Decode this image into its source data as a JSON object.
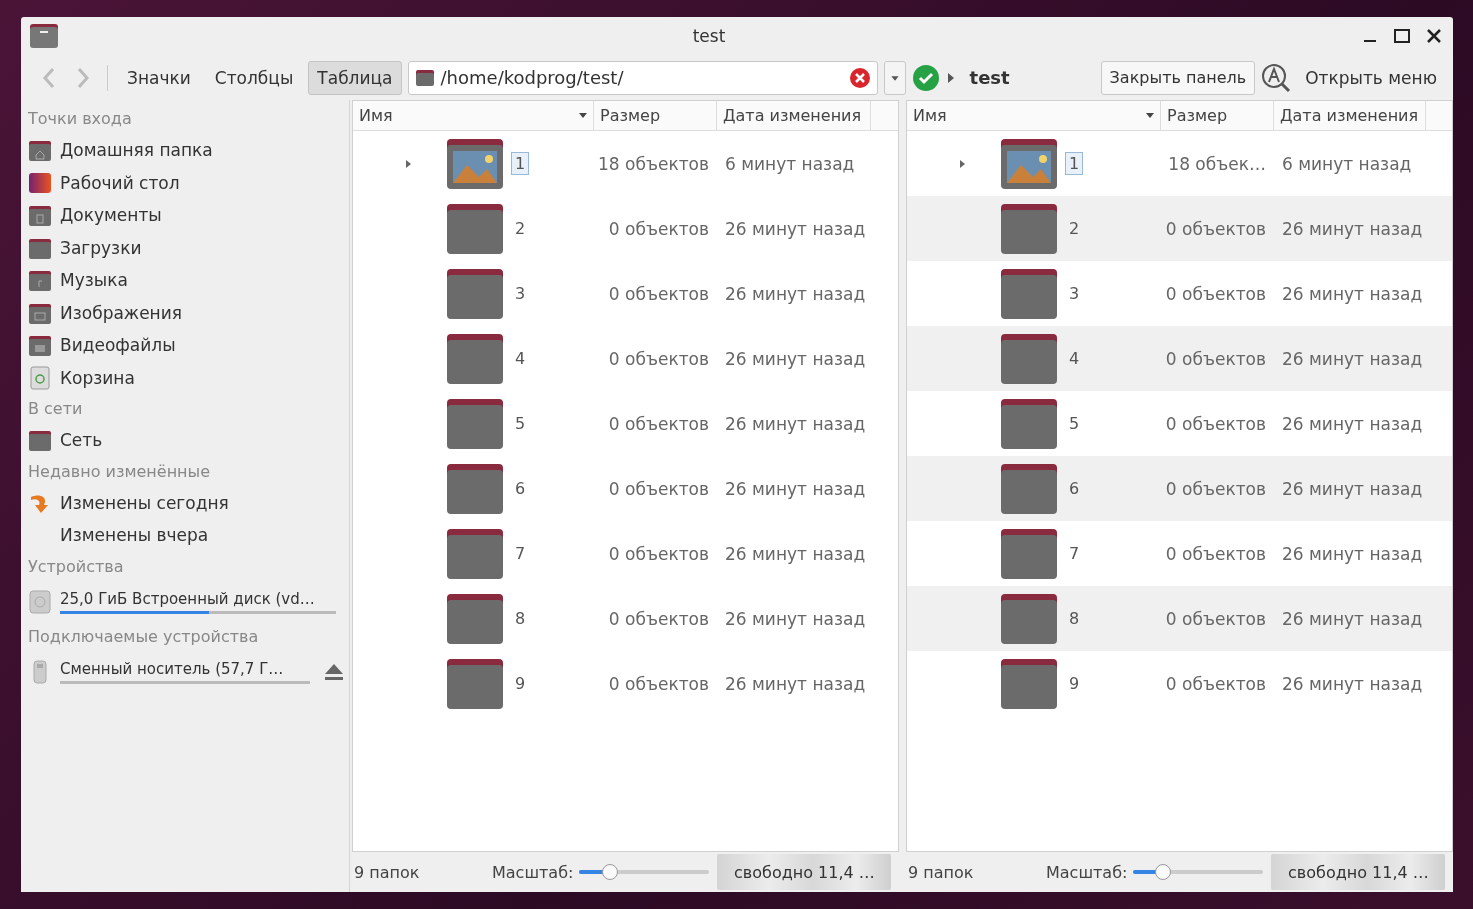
{
  "window": {
    "title": "test"
  },
  "toolbar": {
    "view_buttons": [
      {
        "label": "Значки",
        "selected": false
      },
      {
        "label": "Столбцы",
        "selected": false
      },
      {
        "label": "Таблица",
        "selected": true
      }
    ],
    "path": "/home/kodprog/test/",
    "breadcrumb": "test",
    "close_panel": "Закрыть панель",
    "open_menu": "Открыть меню"
  },
  "sidebar": {
    "sections": [
      {
        "title": "Точки входа",
        "items": [
          {
            "label": "Домашняя папка",
            "kind": "home"
          },
          {
            "label": "Рабочий стол",
            "kind": "desktop"
          },
          {
            "label": "Документы",
            "kind": "documents"
          },
          {
            "label": "Загрузки",
            "kind": "folder"
          },
          {
            "label": "Музыка",
            "kind": "music"
          },
          {
            "label": "Изображения",
            "kind": "pictures"
          },
          {
            "label": "Видеофайлы",
            "kind": "videos"
          },
          {
            "label": "Корзина",
            "kind": "trash"
          }
        ]
      },
      {
        "title": "В сети",
        "items": [
          {
            "label": "Сеть",
            "kind": "folder"
          }
        ]
      },
      {
        "title": "Недавно изменённые",
        "items": [
          {
            "label": "Изменены сегодня",
            "kind": "recent"
          },
          {
            "label": "Изменены вчера",
            "kind": "plain"
          }
        ]
      },
      {
        "title": "Устройства",
        "items": [
          {
            "label": "25,0 ГиБ Встроенный диск (vd…",
            "kind": "disk",
            "level": 0.54,
            "eject": false
          }
        ]
      },
      {
        "title": "Подключаемые устройства",
        "items": [
          {
            "label": "Сменный носитель (57,7 Г…",
            "kind": "usb",
            "level": 0,
            "eject": true
          }
        ]
      }
    ]
  },
  "panes": [
    {
      "striped": false,
      "columns": [
        {
          "label": "Имя",
          "sorted": true
        },
        {
          "label": "Размер",
          "sorted": false
        },
        {
          "label": "Дата изменения",
          "sorted": false
        }
      ],
      "rows": [
        {
          "name": "1",
          "size": "18 объектов",
          "modified": "6 минут назад",
          "kind": "image-folder",
          "expandable": true,
          "focused": true
        },
        {
          "name": "2",
          "size": "0 объектов",
          "modified": "26 минут назад",
          "kind": "folder",
          "expandable": false,
          "focused": false
        },
        {
          "name": "3",
          "size": "0 объектов",
          "modified": "26 минут назад",
          "kind": "folder",
          "expandable": false,
          "focused": false
        },
        {
          "name": "4",
          "size": "0 объектов",
          "modified": "26 минут назад",
          "kind": "folder",
          "expandable": false,
          "focused": false
        },
        {
          "name": "5",
          "size": "0 объектов",
          "modified": "26 минут назад",
          "kind": "folder",
          "expandable": false,
          "focused": false
        },
        {
          "name": "6",
          "size": "0 объектов",
          "modified": "26 минут назад",
          "kind": "folder",
          "expandable": false,
          "focused": false
        },
        {
          "name": "7",
          "size": "0 объектов",
          "modified": "26 минут назад",
          "kind": "folder",
          "expandable": false,
          "focused": false
        },
        {
          "name": "8",
          "size": "0 объектов",
          "modified": "26 минут назад",
          "kind": "folder",
          "expandable": false,
          "focused": false
        },
        {
          "name": "9",
          "size": "0 объектов",
          "modified": "26 минут назад",
          "kind": "folder",
          "expandable": false,
          "focused": false
        }
      ],
      "status": "9 папок",
      "zoom_label": "Масштаб:",
      "zoom": {
        "level": 0.23
      },
      "free_space": "свободно 11,4 …"
    },
    {
      "striped": true,
      "columns": [
        {
          "label": "Имя",
          "sorted": true
        },
        {
          "label": "Размер",
          "sorted": false
        },
        {
          "label": "Дата изменения",
          "sorted": false
        }
      ],
      "rows": [
        {
          "name": "1",
          "size": "18 объек…",
          "modified": "6 минут назад",
          "kind": "image-folder",
          "expandable": true,
          "focused": true
        },
        {
          "name": "2",
          "size": "0 объектов",
          "modified": "26 минут назад",
          "kind": "folder",
          "expandable": false,
          "focused": false
        },
        {
          "name": "3",
          "size": "0 объектов",
          "modified": "26 минут назад",
          "kind": "folder",
          "expandable": false,
          "focused": false
        },
        {
          "name": "4",
          "size": "0 объектов",
          "modified": "26 минут назад",
          "kind": "folder",
          "expandable": false,
          "focused": false
        },
        {
          "name": "5",
          "size": "0 объектов",
          "modified": "26 минут назад",
          "kind": "folder",
          "expandable": false,
          "focused": false
        },
        {
          "name": "6",
          "size": "0 объектов",
          "modified": "26 минут назад",
          "kind": "folder",
          "expandable": false,
          "focused": false
        },
        {
          "name": "7",
          "size": "0 объектов",
          "modified": "26 минут назад",
          "kind": "folder",
          "expandable": false,
          "focused": false
        },
        {
          "name": "8",
          "size": "0 объектов",
          "modified": "26 минут назад",
          "kind": "folder",
          "expandable": false,
          "focused": false
        },
        {
          "name": "9",
          "size": "0 объектов",
          "modified": "26 минут назад",
          "kind": "folder",
          "expandable": false,
          "focused": false
        }
      ],
      "status": "9 папок",
      "zoom_label": "Масштаб:",
      "zoom": {
        "level": 0.22
      },
      "free_space": "свободно 11,4 …"
    }
  ]
}
